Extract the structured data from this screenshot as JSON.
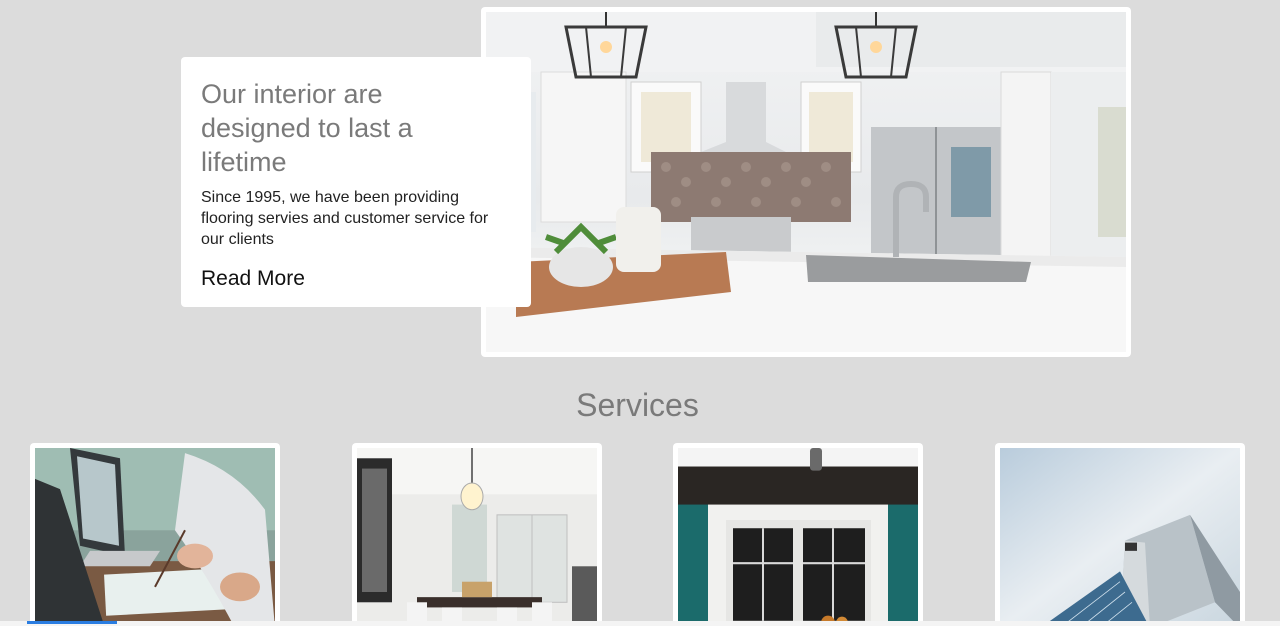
{
  "hero": {
    "title": "Our interior are designed to last a lifetime",
    "description": "Since 1995, we have been providing flooring servies and customer service for our clients",
    "cta_label": "Read More",
    "image_subject": "kitchen-photo"
  },
  "services": {
    "title": "Services",
    "cards": [
      {
        "image_subject": "office-work-photo"
      },
      {
        "image_subject": "dining-room-photo"
      },
      {
        "image_subject": "window-facade-photo"
      },
      {
        "image_subject": "modern-building-photo"
      }
    ]
  },
  "colors": {
    "background": "#dcdcdc",
    "card": "#ffffff",
    "heading": "#7a7a7a",
    "body_text": "#222222",
    "accent": "#2a7de1"
  }
}
